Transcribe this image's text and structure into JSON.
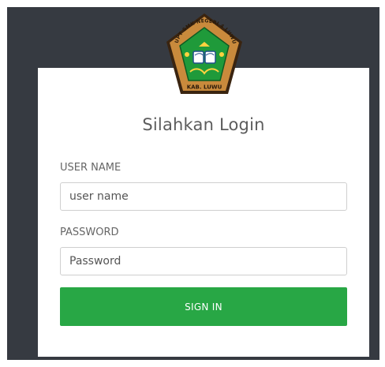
{
  "logo": {
    "icon": "school-emblem-icon",
    "top_text": "UPT SMK NEGERI 4 LUWU",
    "bottom_text": "KAB. LUWU",
    "colors": {
      "border": "#3a2410",
      "frame": "#c98a3c",
      "field": "#1f9a3a"
    }
  },
  "login": {
    "title": "Silahkan Login",
    "username_label": "USER NAME",
    "username_placeholder": "user name",
    "password_label": "PASSWORD",
    "password_placeholder": "Password",
    "signin_label": "SIGN IN"
  },
  "colors": {
    "background": "#363a41",
    "card": "#ffffff",
    "button": "#28a745"
  }
}
